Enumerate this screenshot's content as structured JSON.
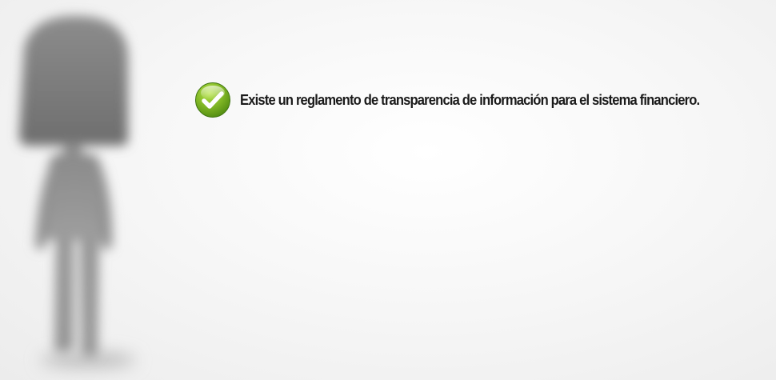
{
  "slide": {
    "statement": "Existe un reglamento de transparencia de información para el sistema financiero.",
    "status_icon": "check-icon",
    "figure_icon": "person-silhouette-icon"
  },
  "colors": {
    "background": "#f4f4f4",
    "text": "#1a1a1a",
    "check_green_light": "#a6d83c",
    "check_green_dark": "#4f8a10",
    "silhouette": "#8a8a8a"
  }
}
